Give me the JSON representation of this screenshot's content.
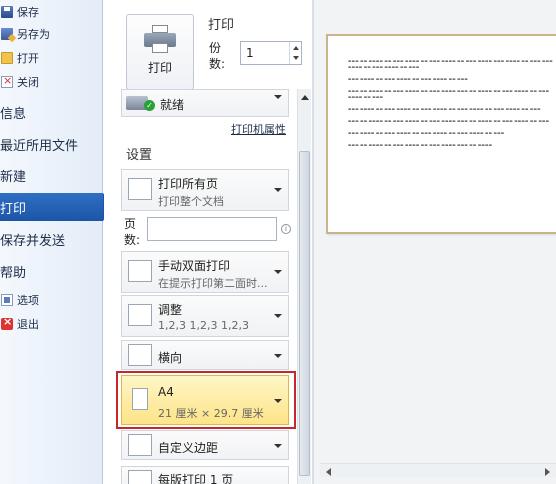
{
  "nav": {
    "top_items": [
      {
        "label": "保存",
        "icon": "save-icon"
      },
      {
        "label": "另存为",
        "icon": "save-as-icon"
      },
      {
        "label": "打开",
        "icon": "open-folder-icon"
      },
      {
        "label": "关闭",
        "icon": "close-document-icon"
      }
    ],
    "big_items": [
      {
        "label": "信息"
      },
      {
        "label": "最近所用文件"
      },
      {
        "label": "新建"
      },
      {
        "label": "打印",
        "selected": true
      },
      {
        "label": "保存并发送"
      },
      {
        "label": "帮助"
      }
    ],
    "bottom_items": [
      {
        "label": "选项",
        "icon": "options-icon"
      },
      {
        "label": "退出",
        "icon": "exit-icon"
      }
    ]
  },
  "print": {
    "section_title": "打印",
    "button_label": "打印",
    "copies_label": "份数:",
    "copies_value": "1"
  },
  "printer": {
    "status": "就绪",
    "properties_link": "打印机属性"
  },
  "settings": {
    "title": "设置",
    "pages_label": "页数:",
    "pages_placeholder": "",
    "options": [
      {
        "line1": "打印所有页",
        "line2": "打印整个文档"
      },
      {
        "line1": "手动双面打印",
        "line2": "在提示打印第二面时..."
      },
      {
        "line1": "调整",
        "line2": "1,2,3    1,2,3    1,2,3"
      },
      {
        "line1": "横向",
        "line2": ""
      },
      {
        "line1": "A4",
        "line2": "21 厘米 × 29.7 厘米",
        "selected": true
      },
      {
        "line1": "自定义边距",
        "line2": ""
      },
      {
        "line1": "每版打印 1 页",
        "line2": ""
      }
    ]
  },
  "colors": {
    "nav_selected": "#1c55a8",
    "highlight_frame": "#c4282d",
    "selected_option": "#fde487"
  }
}
